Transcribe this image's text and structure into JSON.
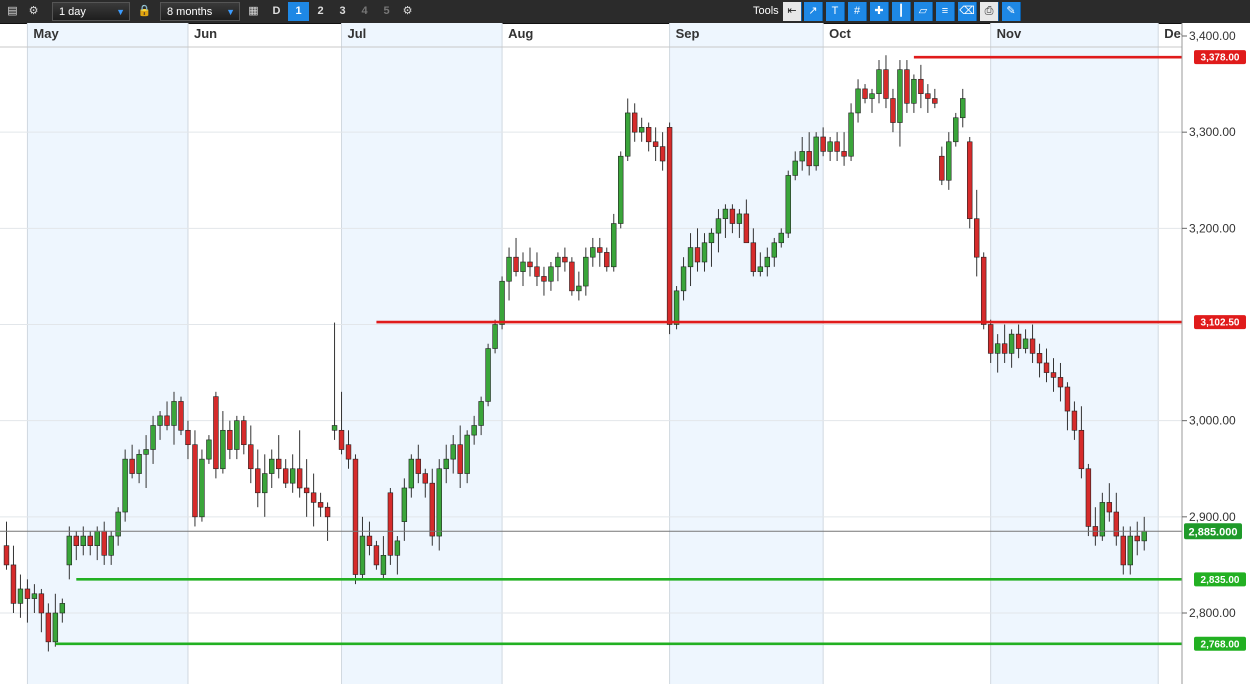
{
  "toolbar": {
    "interval": "1 day",
    "range": "8 months",
    "mode": "D",
    "segments": [
      "1",
      "2",
      "3",
      "4",
      "5"
    ],
    "active_segment": "1",
    "tools_label": "Tools"
  },
  "colors": {
    "up": "#3aa53a",
    "down": "#d62b2b",
    "resistance": "#e01b1b",
    "support": "#22b022",
    "band": "#eef6fe",
    "current": "#1f9a2a"
  },
  "chart_data": {
    "type": "candlestick",
    "ylim": [
      2710,
      3410
    ],
    "y_ticks": [
      {
        "v": 3400,
        "label": "3,400.00"
      },
      {
        "v": 3300,
        "label": "3,300.00"
      },
      {
        "v": 3200,
        "label": "3,200.00"
      },
      {
        "v": 3000,
        "label": "3,000.00"
      },
      {
        "v": 2900,
        "label": "2,900.00"
      },
      {
        "v": 2800,
        "label": "2,800.00"
      }
    ],
    "months": [
      {
        "label": "May",
        "start": 3.5
      },
      {
        "label": "Jun",
        "start": 26.5
      },
      {
        "label": "Jul",
        "start": 48.5
      },
      {
        "label": "Aug",
        "start": 71.5
      },
      {
        "label": "Sep",
        "start": 95.5
      },
      {
        "label": "Oct",
        "start": 117.5
      },
      {
        "label": "Nov",
        "start": 141.5
      },
      {
        "label": "Dec",
        "start": 165.5
      }
    ],
    "levels": [
      {
        "name": "resistance",
        "value": 3378,
        "label": "3,378.00",
        "from": 130.5,
        "color": "#e01b1b"
      },
      {
        "name": "resistance",
        "value": 3102.5,
        "label": "3,102.50",
        "from": 53.5,
        "color": "#e01b1b"
      },
      {
        "name": "support",
        "value": 2835,
        "label": "2,835.00",
        "from": 10.5,
        "color": "#22b022"
      },
      {
        "name": "support",
        "value": 2768,
        "label": "2,768.00",
        "from": 7.5,
        "color": "#22b022"
      }
    ],
    "current": {
      "value": 2885,
      "label": "2,885.000"
    },
    "candles": [
      [
        2870,
        2895,
        2845,
        2850
      ],
      [
        2850,
        2870,
        2800,
        2810
      ],
      [
        2810,
        2840,
        2795,
        2825
      ],
      [
        2825,
        2835,
        2790,
        2815
      ],
      [
        2815,
        2830,
        2800,
        2820
      ],
      [
        2820,
        2825,
        2780,
        2800
      ],
      [
        2800,
        2810,
        2760,
        2770
      ],
      [
        2770,
        2820,
        2765,
        2800
      ],
      [
        2800,
        2815,
        2790,
        2810
      ],
      [
        2850,
        2890,
        2835,
        2880
      ],
      [
        2880,
        2885,
        2855,
        2870
      ],
      [
        2870,
        2890,
        2860,
        2880
      ],
      [
        2880,
        2885,
        2860,
        2870
      ],
      [
        2870,
        2890,
        2855,
        2885
      ],
      [
        2885,
        2895,
        2850,
        2860
      ],
      [
        2860,
        2885,
        2850,
        2880
      ],
      [
        2880,
        2910,
        2870,
        2905
      ],
      [
        2905,
        2970,
        2895,
        2960
      ],
      [
        2960,
        2975,
        2940,
        2945
      ],
      [
        2945,
        2970,
        2935,
        2965
      ],
      [
        2965,
        2985,
        2930,
        2970
      ],
      [
        2970,
        3005,
        2955,
        2995
      ],
      [
        2995,
        3010,
        2980,
        3005
      ],
      [
        3005,
        3020,
        2990,
        2995
      ],
      [
        2995,
        3030,
        2975,
        3020
      ],
      [
        3020,
        3025,
        2985,
        2990
      ],
      [
        2990,
        3000,
        2960,
        2975
      ],
      [
        2975,
        2990,
        2890,
        2900
      ],
      [
        2900,
        2970,
        2895,
        2960
      ],
      [
        2960,
        2985,
        2955,
        2980
      ],
      [
        3025,
        3030,
        2940,
        2950
      ],
      [
        2950,
        3010,
        2945,
        2990
      ],
      [
        2990,
        3000,
        2960,
        2970
      ],
      [
        2970,
        3005,
        2960,
        3000
      ],
      [
        3000,
        3005,
        2965,
        2975
      ],
      [
        2975,
        2995,
        2935,
        2950
      ],
      [
        2950,
        2970,
        2910,
        2925
      ],
      [
        2925,
        2965,
        2900,
        2945
      ],
      [
        2945,
        2970,
        2930,
        2960
      ],
      [
        2960,
        2985,
        2940,
        2950
      ],
      [
        2950,
        2960,
        2930,
        2935
      ],
      [
        2935,
        2965,
        2925,
        2950
      ],
      [
        2950,
        2990,
        2920,
        2930
      ],
      [
        2930,
        2960,
        2900,
        2925
      ],
      [
        2925,
        2945,
        2890,
        2915
      ],
      [
        2915,
        2925,
        2900,
        2910
      ],
      [
        2910,
        2915,
        2875,
        2900
      ],
      [
        2990,
        3102,
        2980,
        2995
      ],
      [
        2990,
        3030,
        2965,
        2970
      ],
      [
        2975,
        2990,
        2950,
        2960
      ],
      [
        2960,
        2965,
        2830,
        2840
      ],
      [
        2840,
        2900,
        2835,
        2880
      ],
      [
        2880,
        2895,
        2860,
        2870
      ],
      [
        2870,
        2875,
        2845,
        2850
      ],
      [
        2840,
        2880,
        2835,
        2860
      ],
      [
        2925,
        2930,
        2850,
        2860
      ],
      [
        2860,
        2880,
        2840,
        2875
      ],
      [
        2895,
        2940,
        2875,
        2930
      ],
      [
        2930,
        2965,
        2920,
        2960
      ],
      [
        2960,
        2975,
        2935,
        2945
      ],
      [
        2945,
        2950,
        2920,
        2935
      ],
      [
        2935,
        2950,
        2870,
        2880
      ],
      [
        2880,
        2960,
        2865,
        2950
      ],
      [
        2950,
        2975,
        2935,
        2960
      ],
      [
        2960,
        2985,
        2945,
        2975
      ],
      [
        2975,
        2995,
        2930,
        2945
      ],
      [
        2945,
        2990,
        2935,
        2985
      ],
      [
        2985,
        3005,
        2975,
        2995
      ],
      [
        2995,
        3025,
        2985,
        3020
      ],
      [
        3020,
        3080,
        3015,
        3075
      ],
      [
        3075,
        3105,
        3070,
        3100
      ],
      [
        3100,
        3150,
        3095,
        3145
      ],
      [
        3145,
        3180,
        3125,
        3170
      ],
      [
        3170,
        3190,
        3150,
        3155
      ],
      [
        3155,
        3175,
        3140,
        3165
      ],
      [
        3165,
        3180,
        3150,
        3160
      ],
      [
        3160,
        3175,
        3140,
        3150
      ],
      [
        3150,
        3160,
        3130,
        3145
      ],
      [
        3145,
        3165,
        3135,
        3160
      ],
      [
        3160,
        3175,
        3145,
        3170
      ],
      [
        3170,
        3180,
        3155,
        3165
      ],
      [
        3165,
        3170,
        3130,
        3135
      ],
      [
        3135,
        3155,
        3125,
        3140
      ],
      [
        3140,
        3180,
        3130,
        3170
      ],
      [
        3170,
        3190,
        3160,
        3180
      ],
      [
        3180,
        3190,
        3160,
        3175
      ],
      [
        3175,
        3180,
        3155,
        3160
      ],
      [
        3160,
        3215,
        3155,
        3205
      ],
      [
        3205,
        3280,
        3200,
        3275
      ],
      [
        3275,
        3335,
        3270,
        3320
      ],
      [
        3320,
        3330,
        3290,
        3300
      ],
      [
        3300,
        3315,
        3290,
        3305
      ],
      [
        3305,
        3310,
        3280,
        3290
      ],
      [
        3290,
        3305,
        3270,
        3285
      ],
      [
        3285,
        3300,
        3260,
        3270
      ],
      [
        3305,
        3310,
        3090,
        3100
      ],
      [
        3100,
        3140,
        3095,
        3135
      ],
      [
        3135,
        3170,
        3125,
        3160
      ],
      [
        3160,
        3195,
        3140,
        3180
      ],
      [
        3180,
        3200,
        3155,
        3165
      ],
      [
        3165,
        3195,
        3155,
        3185
      ],
      [
        3185,
        3200,
        3160,
        3195
      ],
      [
        3195,
        3220,
        3175,
        3210
      ],
      [
        3210,
        3225,
        3190,
        3220
      ],
      [
        3220,
        3225,
        3195,
        3205
      ],
      [
        3205,
        3220,
        3190,
        3215
      ],
      [
        3215,
        3230,
        3200,
        3185
      ],
      [
        3185,
        3200,
        3150,
        3155
      ],
      [
        3155,
        3175,
        3150,
        3160
      ],
      [
        3160,
        3180,
        3150,
        3170
      ],
      [
        3170,
        3190,
        3160,
        3185
      ],
      [
        3185,
        3200,
        3180,
        3195
      ],
      [
        3195,
        3260,
        3190,
        3255
      ],
      [
        3255,
        3280,
        3250,
        3270
      ],
      [
        3270,
        3295,
        3260,
        3280
      ],
      [
        3280,
        3300,
        3255,
        3265
      ],
      [
        3265,
        3300,
        3260,
        3295
      ],
      [
        3295,
        3305,
        3275,
        3280
      ],
      [
        3280,
        3295,
        3270,
        3290
      ],
      [
        3290,
        3300,
        3270,
        3280
      ],
      [
        3280,
        3300,
        3265,
        3275
      ],
      [
        3275,
        3330,
        3270,
        3320
      ],
      [
        3320,
        3355,
        3310,
        3345
      ],
      [
        3345,
        3350,
        3330,
        3335
      ],
      [
        3335,
        3345,
        3320,
        3340
      ],
      [
        3340,
        3375,
        3330,
        3365
      ],
      [
        3365,
        3380,
        3325,
        3335
      ],
      [
        3335,
        3345,
        3300,
        3310
      ],
      [
        3310,
        3375,
        3285,
        3365
      ],
      [
        3365,
        3375,
        3320,
        3330
      ],
      [
        3330,
        3360,
        3320,
        3355
      ],
      [
        3355,
        3370,
        3325,
        3340
      ],
      [
        3340,
        3350,
        3320,
        3335
      ],
      [
        3335,
        3345,
        3325,
        3330
      ],
      [
        3275,
        3285,
        3245,
        3250
      ],
      [
        3250,
        3300,
        3240,
        3290
      ],
      [
        3290,
        3320,
        3285,
        3315
      ],
      [
        3315,
        3345,
        3305,
        3335
      ],
      [
        3290,
        3295,
        3200,
        3210
      ],
      [
        3210,
        3240,
        3150,
        3170
      ],
      [
        3170,
        3175,
        3095,
        3100
      ],
      [
        3100,
        3105,
        3060,
        3070
      ],
      [
        3070,
        3090,
        3050,
        3080
      ],
      [
        3080,
        3100,
        3060,
        3070
      ],
      [
        3070,
        3095,
        3055,
        3090
      ],
      [
        3090,
        3100,
        3065,
        3075
      ],
      [
        3075,
        3095,
        3070,
        3085
      ],
      [
        3085,
        3100,
        3060,
        3070
      ],
      [
        3070,
        3080,
        3045,
        3060
      ],
      [
        3060,
        3075,
        3040,
        3050
      ],
      [
        3050,
        3065,
        3030,
        3045
      ],
      [
        3045,
        3060,
        3020,
        3035
      ],
      [
        3035,
        3040,
        2990,
        3010
      ],
      [
        3010,
        3020,
        2980,
        2990
      ],
      [
        2990,
        3015,
        2940,
        2950
      ],
      [
        2950,
        2955,
        2880,
        2890
      ],
      [
        2890,
        2910,
        2870,
        2880
      ],
      [
        2880,
        2925,
        2875,
        2915
      ],
      [
        2915,
        2935,
        2895,
        2905
      ],
      [
        2905,
        2925,
        2870,
        2880
      ],
      [
        2880,
        2890,
        2840,
        2850
      ],
      [
        2850,
        2890,
        2840,
        2880
      ],
      [
        2880,
        2895,
        2860,
        2875
      ],
      [
        2875,
        2900,
        2865,
        2885
      ]
    ]
  }
}
